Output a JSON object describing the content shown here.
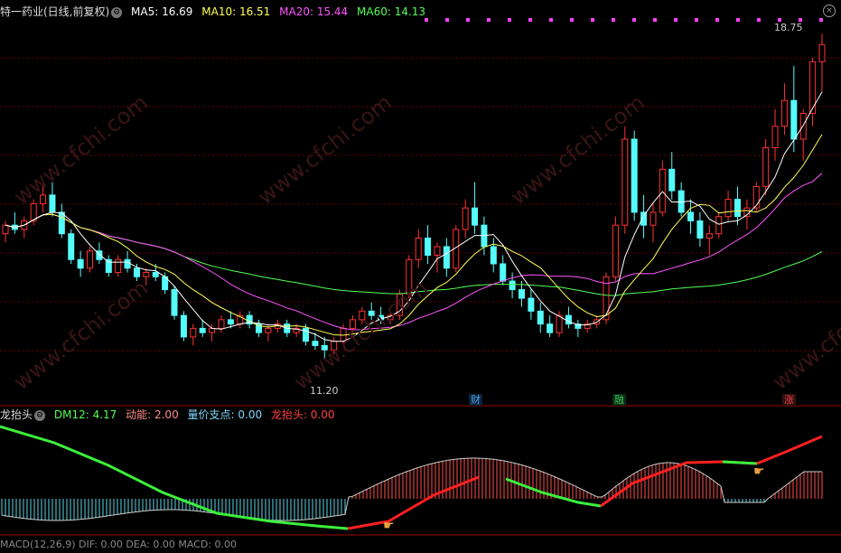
{
  "top_header": {
    "title": "特一药业(日线,前复权)",
    "ma5": "MA5: 16.69",
    "ma10": "MA10: 16.51",
    "ma20": "MA20: 15.44",
    "ma60": "MA60: 14.13"
  },
  "sub_header": {
    "name": "龙抬头",
    "dm12": "DM12: 4.17",
    "dongneng": "动能: 2.00",
    "liangjia": "量价支点: 0.00",
    "longtaitou": "龙抬头: 0.00"
  },
  "bottom_cut_text": "MACD(12,26,9)  DIF: 0.00  DEA: 0.00  MACD: 0.00",
  "price_labels": {
    "high": "18.75",
    "low": "11.20"
  },
  "markers": [
    {
      "label": "财",
      "color": "#4aa3e8"
    },
    {
      "label": "融",
      "color": "#3cc05c"
    },
    {
      "label": "涨",
      "color": "#e84040"
    }
  ],
  "watermark": "www.cfchi.com",
  "colors": {
    "up": "#ff3232",
    "down": "#54fcfc",
    "ma5": "#ffffff",
    "ma10": "#ffff54",
    "ma20": "#ff54ff",
    "ma60": "#54ff54",
    "grid": "#700000"
  },
  "chart_data": {
    "type": "candlestick",
    "ylim": [
      10.5,
      19.2
    ],
    "candles": [
      [
        14.1,
        14.4,
        13.9,
        14.3
      ],
      [
        14.3,
        14.6,
        14.1,
        14.2
      ],
      [
        14.2,
        14.5,
        14.0,
        14.4
      ],
      [
        14.4,
        14.9,
        14.3,
        14.8
      ],
      [
        14.8,
        15.2,
        14.6,
        15.0
      ],
      [
        15.0,
        15.3,
        14.5,
        14.6
      ],
      [
        14.6,
        14.8,
        14.0,
        14.1
      ],
      [
        14.1,
        14.2,
        13.4,
        13.5
      ],
      [
        13.5,
        13.7,
        13.1,
        13.3
      ],
      [
        13.3,
        13.8,
        13.2,
        13.7
      ],
      [
        13.7,
        13.9,
        13.4,
        13.5
      ],
      [
        13.5,
        13.6,
        13.1,
        13.2
      ],
      [
        13.2,
        13.6,
        13.1,
        13.5
      ],
      [
        13.5,
        13.7,
        13.2,
        13.3
      ],
      [
        13.3,
        13.4,
        13.0,
        13.1
      ],
      [
        13.1,
        13.3,
        12.9,
        13.2
      ],
      [
        13.2,
        13.4,
        13.0,
        13.1
      ],
      [
        13.1,
        13.2,
        12.7,
        12.8
      ],
      [
        12.8,
        12.9,
        12.1,
        12.2
      ],
      [
        12.2,
        12.3,
        11.6,
        11.7
      ],
      [
        11.7,
        12.0,
        11.5,
        11.9
      ],
      [
        11.9,
        12.1,
        11.7,
        11.8
      ],
      [
        11.8,
        12.0,
        11.6,
        11.9
      ],
      [
        11.9,
        12.2,
        11.8,
        12.1
      ],
      [
        12.1,
        12.3,
        11.9,
        12.0
      ],
      [
        12.0,
        12.3,
        11.9,
        12.2
      ],
      [
        12.2,
        12.3,
        11.9,
        12.0
      ],
      [
        12.0,
        12.1,
        11.7,
        11.8
      ],
      [
        11.8,
        12.0,
        11.6,
        11.9
      ],
      [
        11.9,
        12.1,
        11.8,
        12.0
      ],
      [
        12.0,
        12.1,
        11.7,
        11.8
      ],
      [
        11.8,
        12.0,
        11.7,
        11.9
      ],
      [
        11.9,
        12.0,
        11.5,
        11.6
      ],
      [
        11.6,
        11.8,
        11.4,
        11.5
      ],
      [
        11.5,
        11.7,
        11.2,
        11.4
      ],
      [
        11.4,
        11.7,
        11.3,
        11.6
      ],
      [
        11.6,
        12.0,
        11.5,
        11.9
      ],
      [
        11.9,
        12.2,
        11.8,
        12.1
      ],
      [
        12.1,
        12.4,
        12.0,
        12.3
      ],
      [
        12.3,
        12.5,
        12.1,
        12.2
      ],
      [
        12.2,
        12.4,
        12.0,
        12.1
      ],
      [
        12.1,
        12.3,
        12.0,
        12.2
      ],
      [
        12.2,
        12.8,
        12.1,
        12.7
      ],
      [
        12.7,
        13.6,
        12.6,
        13.5
      ],
      [
        13.5,
        14.2,
        13.3,
        14.0
      ],
      [
        14.0,
        14.3,
        13.4,
        13.6
      ],
      [
        13.6,
        13.9,
        13.2,
        13.8
      ],
      [
        13.8,
        14.0,
        13.1,
        13.3
      ],
      [
        13.3,
        14.3,
        13.2,
        14.2
      ],
      [
        14.2,
        14.9,
        14.0,
        14.7
      ],
      [
        14.7,
        15.3,
        14.1,
        14.3
      ],
      [
        14.3,
        14.5,
        13.6,
        13.8
      ],
      [
        13.8,
        14.0,
        13.2,
        13.4
      ],
      [
        13.4,
        13.6,
        12.9,
        13.0
      ],
      [
        13.0,
        13.2,
        12.6,
        12.8
      ],
      [
        12.8,
        13.0,
        12.4,
        12.6
      ],
      [
        12.6,
        12.8,
        12.1,
        12.3
      ],
      [
        12.3,
        12.5,
        11.8,
        12.0
      ],
      [
        12.0,
        12.2,
        11.7,
        11.8
      ],
      [
        11.8,
        12.3,
        11.7,
        12.2
      ],
      [
        12.2,
        12.4,
        11.9,
        12.0
      ],
      [
        12.0,
        12.1,
        11.7,
        11.9
      ],
      [
        11.9,
        12.1,
        11.8,
        12.0
      ],
      [
        12.0,
        12.2,
        11.9,
        12.1
      ],
      [
        12.1,
        13.2,
        12.0,
        13.1
      ],
      [
        13.1,
        14.5,
        13.0,
        14.3
      ],
      [
        14.3,
        16.6,
        14.1,
        16.3
      ],
      [
        16.3,
        16.5,
        14.4,
        14.6
      ],
      [
        14.6,
        15.0,
        14.0,
        14.3
      ],
      [
        14.3,
        14.8,
        13.9,
        14.6
      ],
      [
        14.6,
        15.8,
        14.5,
        15.6
      ],
      [
        15.6,
        16.0,
        14.9,
        15.1
      ],
      [
        15.1,
        15.3,
        14.5,
        14.6
      ],
      [
        14.6,
        14.9,
        14.1,
        14.4
      ],
      [
        14.4,
        14.6,
        13.8,
        14.0
      ],
      [
        14.0,
        14.3,
        13.6,
        14.1
      ],
      [
        14.1,
        14.6,
        14.0,
        14.5
      ],
      [
        14.5,
        15.1,
        14.4,
        14.9
      ],
      [
        14.9,
        15.2,
        14.3,
        14.5
      ],
      [
        14.5,
        14.9,
        14.2,
        14.7
      ],
      [
        14.7,
        15.3,
        14.6,
        15.2
      ],
      [
        15.2,
        16.3,
        15.0,
        16.1
      ],
      [
        16.1,
        17.0,
        15.8,
        16.6
      ],
      [
        16.6,
        17.6,
        16.4,
        17.2
      ],
      [
        17.2,
        18.0,
        16.0,
        16.3
      ],
      [
        16.3,
        17.0,
        15.8,
        16.9
      ],
      [
        16.9,
        18.2,
        16.6,
        18.1
      ],
      [
        18.1,
        18.75,
        17.4,
        18.5
      ]
    ]
  }
}
